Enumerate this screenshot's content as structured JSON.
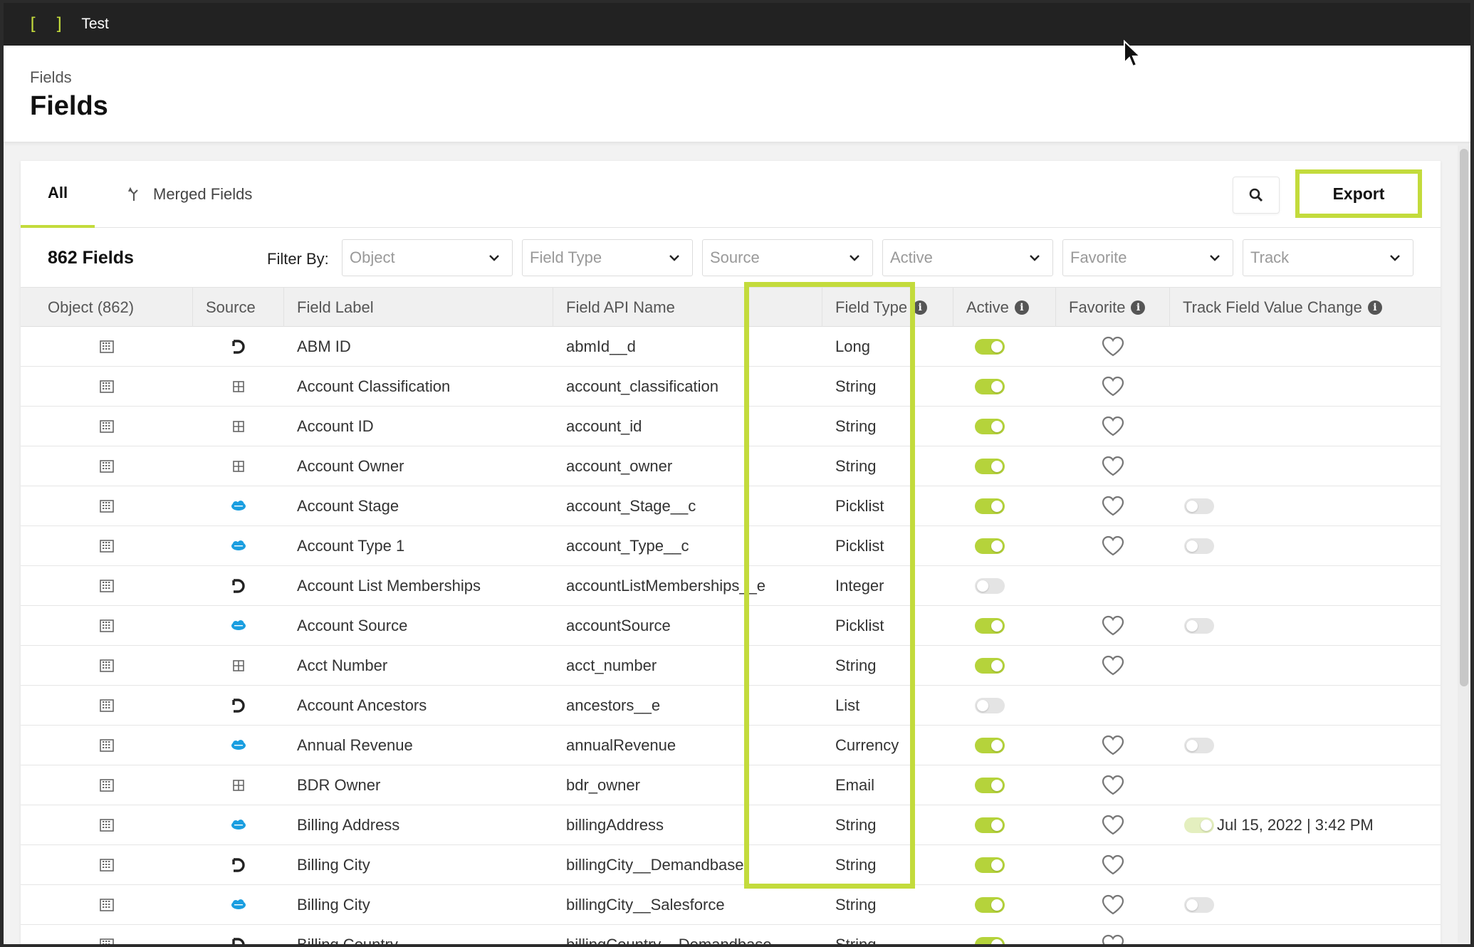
{
  "app": {
    "brand": "[ ]",
    "name": "Test"
  },
  "header": {
    "breadcrumb": "Fields",
    "title": "Fields"
  },
  "tabs": [
    {
      "label": "All",
      "selected": true
    },
    {
      "label": "Merged Fields",
      "icon": "merge-icon"
    }
  ],
  "toolbar": {
    "export_label": "Export",
    "search_icon": "search-icon"
  },
  "filters": {
    "count_label": "862 Fields",
    "filter_by_label": "Filter By:",
    "selects": [
      {
        "placeholder": "Object"
      },
      {
        "placeholder": "Field Type"
      },
      {
        "placeholder": "Source"
      },
      {
        "placeholder": "Active"
      },
      {
        "placeholder": "Favorite"
      },
      {
        "placeholder": "Track"
      }
    ]
  },
  "columns": {
    "object": "Object (862)",
    "source": "Source",
    "field_label": "Field Label",
    "field_api": "Field API Name",
    "field_type": "Field Type",
    "active": "Active",
    "favorite": "Favorite",
    "track": "Track Field Value Change"
  },
  "colors": {
    "accent": "#c3db3c",
    "toggle_on": "#b5d33b",
    "salesforce": "#1a9ee0"
  },
  "rows": [
    {
      "source": "demandbase",
      "label": "ABM ID",
      "api": "abmId__d",
      "type": "Long",
      "active": true,
      "favorite": true,
      "track": "none",
      "track_text": ""
    },
    {
      "source": "table",
      "label": "Account Classification",
      "api": "account_classification",
      "type": "String",
      "active": true,
      "favorite": true,
      "track": "none",
      "track_text": ""
    },
    {
      "source": "table",
      "label": "Account ID",
      "api": "account_id",
      "type": "String",
      "active": true,
      "favorite": true,
      "track": "none",
      "track_text": ""
    },
    {
      "source": "table",
      "label": "Account Owner",
      "api": "account_owner",
      "type": "String",
      "active": true,
      "favorite": true,
      "track": "none",
      "track_text": ""
    },
    {
      "source": "salesforce",
      "label": "Account Stage",
      "api": "account_Stage__c",
      "type": "Picklist",
      "active": true,
      "favorite": true,
      "track": "off",
      "track_text": ""
    },
    {
      "source": "salesforce",
      "label": "Account Type 1",
      "api": "account_Type__c",
      "type": "Picklist",
      "active": true,
      "favorite": true,
      "track": "off",
      "track_text": ""
    },
    {
      "source": "demandbase",
      "label": "Account List Memberships",
      "api": "accountListMemberships__e",
      "type": "Integer",
      "active": false,
      "favorite": false,
      "track": "none",
      "track_text": ""
    },
    {
      "source": "salesforce",
      "label": "Account Source",
      "api": "accountSource",
      "type": "Picklist",
      "active": true,
      "favorite": true,
      "track": "off",
      "track_text": ""
    },
    {
      "source": "table",
      "label": "Acct Number",
      "api": "acct_number",
      "type": "String",
      "active": true,
      "favorite": true,
      "track": "none",
      "track_text": ""
    },
    {
      "source": "demandbase",
      "label": "Account Ancestors",
      "api": "ancestors__e",
      "type": "List",
      "active": false,
      "favorite": false,
      "track": "none",
      "track_text": ""
    },
    {
      "source": "salesforce",
      "label": "Annual Revenue",
      "api": "annualRevenue",
      "type": "Currency",
      "active": true,
      "favorite": true,
      "track": "off",
      "track_text": ""
    },
    {
      "source": "table",
      "label": "BDR Owner",
      "api": "bdr_owner",
      "type": "Email",
      "active": true,
      "favorite": true,
      "track": "none",
      "track_text": ""
    },
    {
      "source": "salesforce",
      "label": "Billing Address",
      "api": "billingAddress",
      "type": "String",
      "active": true,
      "favorite": true,
      "track": "on",
      "track_text": "Jul 15, 2022 | 3:42 PM"
    },
    {
      "source": "demandbase",
      "label": "Billing City",
      "api": "billingCity__Demandbase",
      "type": "String",
      "active": true,
      "favorite": true,
      "track": "none",
      "track_text": ""
    },
    {
      "source": "salesforce",
      "label": "Billing City",
      "api": "billingCity__Salesforce",
      "type": "String",
      "active": true,
      "favorite": true,
      "track": "off",
      "track_text": ""
    },
    {
      "source": "demandbase",
      "label": "Billing Country",
      "api": "billingCountry__Demandbase",
      "type": "String",
      "active": true,
      "favorite": true,
      "track": "none",
      "track_text": ""
    }
  ]
}
